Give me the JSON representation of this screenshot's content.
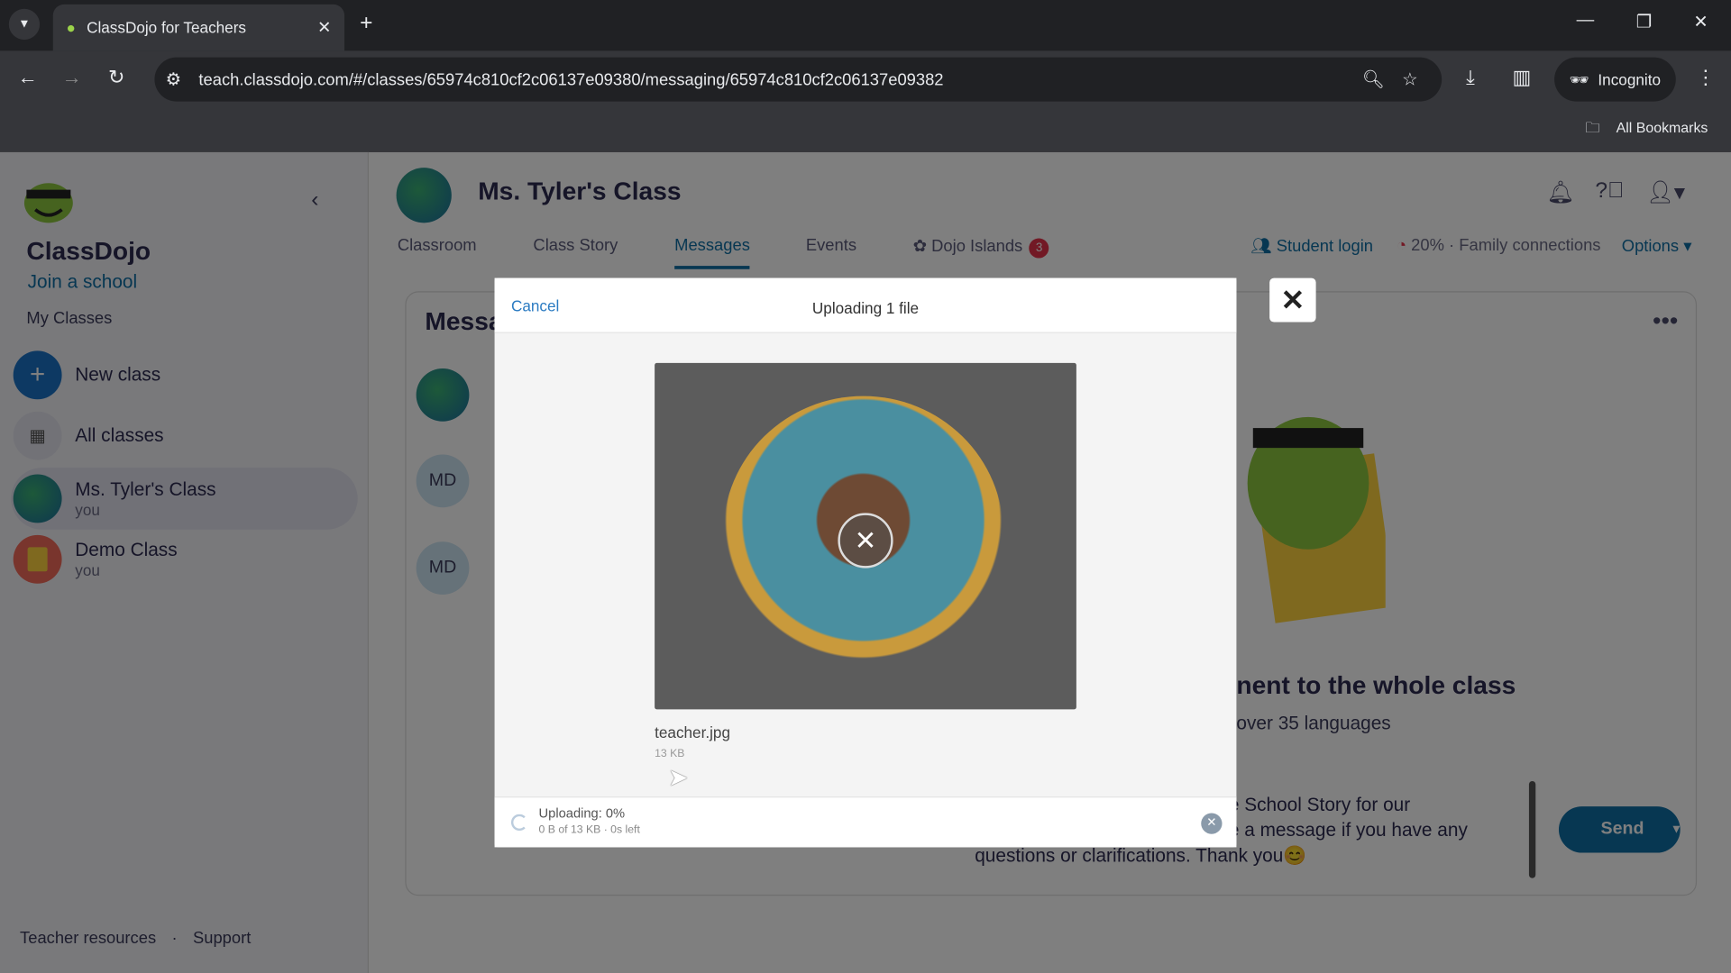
{
  "browser": {
    "tab_title": "ClassDojo for Teachers",
    "url": "teach.classdojo.com/#/classes/65974c810cf2c06137e09380/messaging/65974c810cf2c06137e09382",
    "incognito_label": "Incognito",
    "bookmarks_label": "All Bookmarks"
  },
  "sidebar": {
    "brand": "ClassDojo",
    "join_school": "Join a school",
    "section": "My Classes",
    "new_class": "New class",
    "all_classes": "All classes",
    "classes": [
      {
        "name": "Ms. Tyler's Class",
        "role": "you",
        "active": true
      },
      {
        "name": "Demo Class",
        "role": "you",
        "active": false
      }
    ],
    "footer": {
      "resources": "Teacher resources",
      "separator": "·",
      "support": "Support"
    }
  },
  "header": {
    "class_name": "Ms. Tyler's Class",
    "tabs": [
      {
        "label": "Classroom"
      },
      {
        "label": "Class Story"
      },
      {
        "label": "Messages",
        "active": true
      },
      {
        "label": "Events"
      },
      {
        "label": "Dojo Islands",
        "badge": "3"
      }
    ],
    "student_login": "Student login",
    "family_connections": "20% · Family connections",
    "options": "Options"
  },
  "messages": {
    "title_partial": "Messa",
    "conversations": [
      {
        "initials": ""
      },
      {
        "initials": "MD"
      },
      {
        "initials": "MD"
      }
    ],
    "hero_title_partial": "nent to the whole class",
    "hero_sub_partial": "over 35 languages",
    "draft_line1": "e School Story for our",
    "draft_line2": "e a message if you have any",
    "draft_line3": "questions or clarifications. Thank you😊",
    "send_label": "Send"
  },
  "upload_modal": {
    "cancel": "Cancel",
    "title": "Uploading 1 file",
    "file_name": "teacher.jpg",
    "file_size": "13 KB",
    "status": "Uploading: 0%",
    "detail": "0 B of 13 KB · 0s left",
    "progress_percent": 0
  },
  "colors": {
    "accent": "#0f6fa5",
    "badge": "#e5334b"
  }
}
